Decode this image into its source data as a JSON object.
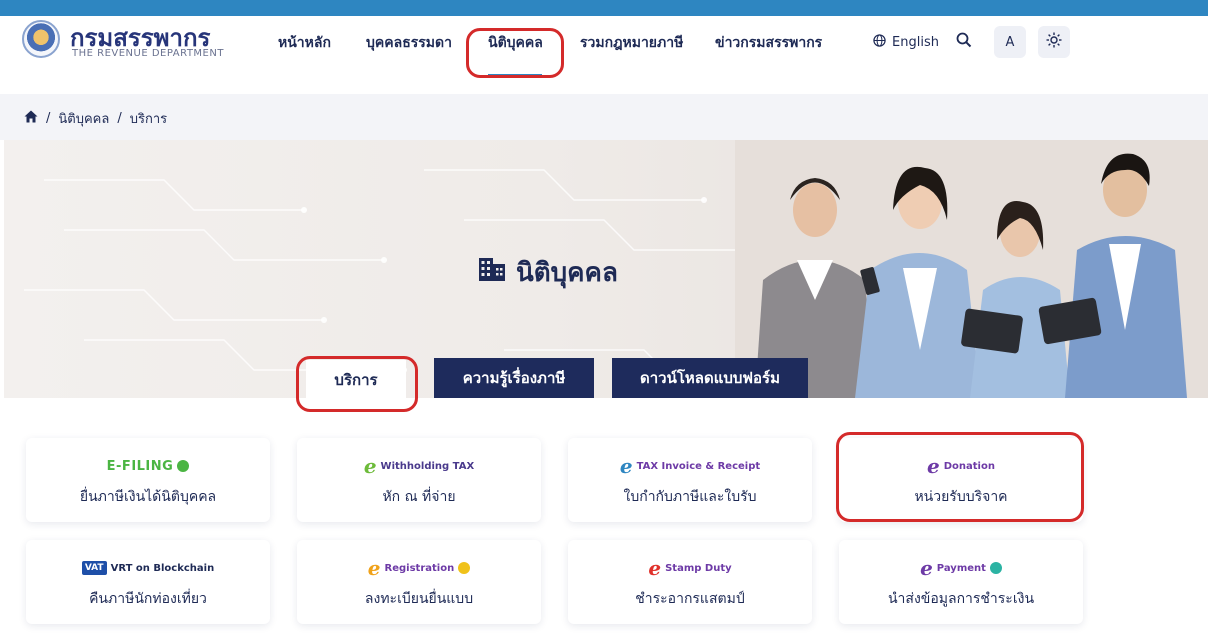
{
  "header": {
    "logo_main": "กรมสรรพากร",
    "logo_sub": "THE REVENUE DEPARTMENT",
    "nav": [
      {
        "label": "หน้าหลัก"
      },
      {
        "label": "บุคคลธรรมดา"
      },
      {
        "label": "นิติบุคคล"
      },
      {
        "label": "รวมกฎหมายภาษี"
      },
      {
        "label": "ข่าวกรมสรรพากร"
      }
    ],
    "active_nav": "นิติบุคคล",
    "language_label": "English",
    "font_size_label": "A",
    "search_icon": "search-icon",
    "theme_icon": "sun-icon"
  },
  "breadcrumb": {
    "home_icon": "home-icon",
    "separator": "/",
    "items": [
      "นิติบุคคล",
      "บริการ"
    ]
  },
  "hero": {
    "title": "นิติบุคคล",
    "title_icon": "building-icon"
  },
  "tabs": [
    {
      "label": "บริการ",
      "active": true
    },
    {
      "label": "ความรู้เรื่องภาษี",
      "active": false
    },
    {
      "label": "ดาวน์โหลดแบบฟอร์ม",
      "active": false
    }
  ],
  "services": [
    {
      "logo_text": "E-FILING",
      "label": "ยื่นภาษีเงินได้นิติบุคคล"
    },
    {
      "logo_text": "Withholding TAX",
      "label": "หัก ณ ที่จ่าย"
    },
    {
      "logo_text": "TAX Invoice & Receipt",
      "label": "ใบกำกับภาษีและใบรับ"
    },
    {
      "logo_text": "Donation",
      "label": "หน่วยรับบริจาค"
    },
    {
      "logo_text": "VRT on Blockchain",
      "logo_badge": "VAT",
      "label": "คืนภาษีนักท่องเที่ยว"
    },
    {
      "logo_text": "Registration",
      "label": "ลงทะเบียนยื่นแบบ"
    },
    {
      "logo_text": "Stamp Duty",
      "label": "ชำระอากรแสตมป์"
    },
    {
      "logo_text": "Payment",
      "label": "นำส่งข้อมูลการชำระเงิน"
    }
  ],
  "colors": {
    "topbar": "#2e86c1",
    "navy": "#1e2a55",
    "tab_dark": "#1e2b5c",
    "highlight": "#d42a2a",
    "efiling_green": "#4bb543",
    "e_purple": "#6d3aa6",
    "e_orange": "#f0a21a"
  }
}
